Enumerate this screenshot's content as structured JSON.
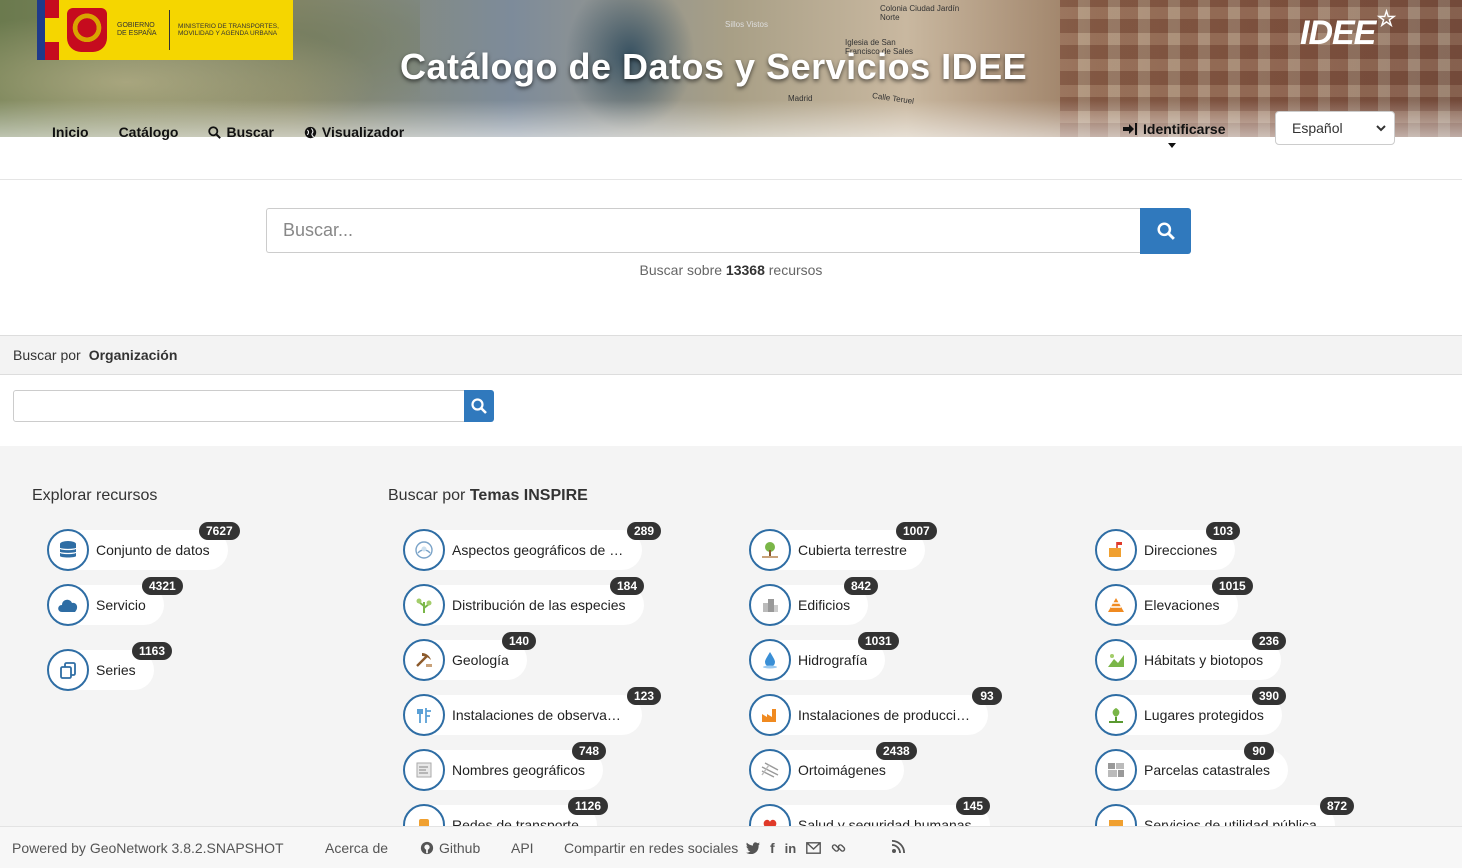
{
  "header": {
    "gov_text": "Gobierno de España",
    "ministry_text": "Ministerio de Transportes, Movilidad y Agenda Urbana",
    "site_title": "Catálogo de Datos y Servicios IDEE",
    "logo_text": "IDEE",
    "map_labels": [
      "Colonia Ciudad Jardín Norte",
      "Iglesia de San Francisco de Sales",
      "Calle Teruel",
      "Madrid",
      "Sillos Vistos"
    ],
    "nav": [
      {
        "label": "Inicio",
        "icon": ""
      },
      {
        "label": "Catálogo",
        "icon": ""
      },
      {
        "label": "Buscar",
        "icon": "search-icon"
      },
      {
        "label": "Visualizador",
        "icon": "globe-icon"
      }
    ],
    "login_label": "Identificarse",
    "language": "Español"
  },
  "search": {
    "placeholder": "Buscar...",
    "count_prefix": "Buscar sobre",
    "count_value": "13368",
    "count_suffix": "recursos"
  },
  "org_search": {
    "prefix": "Buscar por",
    "label": "Organización"
  },
  "explore": {
    "title": "Explorar recursos",
    "items": [
      {
        "label": "Conjunto de datos",
        "count": "7627",
        "icon": "database-icon"
      },
      {
        "label": "Servicio",
        "count": "4321",
        "icon": "cloud-icon"
      },
      {
        "label": "Series",
        "count": "1163",
        "icon": "copy-icon"
      }
    ]
  },
  "inspire": {
    "title_prefix": "Buscar por",
    "title_bold": "Temas INSPIRE",
    "col1": [
      {
        "label": "Aspectos geográficos de car...",
        "count": "289",
        "icon": "meteorological-icon"
      },
      {
        "label": "Distribución de las especies",
        "count": "184",
        "icon": "species-icon"
      },
      {
        "label": "Geología",
        "count": "140",
        "icon": "geology-icon"
      },
      {
        "label": "Instalaciones de observació...",
        "count": "123",
        "icon": "monitoring-icon"
      },
      {
        "label": "Nombres geográficos",
        "count": "748",
        "icon": "geographic-names-icon"
      },
      {
        "label": "Redes de transporte",
        "count": "1126",
        "icon": "transport-icon"
      }
    ],
    "col2": [
      {
        "label": "Cubierta terrestre",
        "count": "1007",
        "icon": "land-cover-icon"
      },
      {
        "label": "Edificios",
        "count": "842",
        "icon": "buildings-icon"
      },
      {
        "label": "Hidrografía",
        "count": "1031",
        "icon": "hydrography-icon"
      },
      {
        "label": "Instalaciones de producción ...",
        "count": "93",
        "icon": "production-icon"
      },
      {
        "label": "Ortoimágenes",
        "count": "2438",
        "icon": "orthoimagery-icon"
      },
      {
        "label": "Salud y seguridad humanas",
        "count": "145",
        "icon": "health-icon"
      }
    ],
    "col3": [
      {
        "label": "Direcciones",
        "count": "103",
        "icon": "addresses-icon"
      },
      {
        "label": "Elevaciones",
        "count": "1015",
        "icon": "elevation-icon"
      },
      {
        "label": "Hábitats y biotopos",
        "count": "236",
        "icon": "habitats-icon"
      },
      {
        "label": "Lugares protegidos",
        "count": "390",
        "icon": "protected-sites-icon"
      },
      {
        "label": "Parcelas catastrales",
        "count": "90",
        "icon": "cadastral-icon"
      },
      {
        "label": "Servicios de utilidad pública",
        "count": "872",
        "icon": "utility-icon"
      }
    ]
  },
  "footer": {
    "powered": "Powered by GeoNetwork 3.8.2.SNAPSHOT",
    "about": "Acerca de",
    "github": "Github",
    "api": "API",
    "share": "Compartir en redes sociales"
  },
  "colors": {
    "accent": "#3079bd",
    "icon_ring": "#2e6da4",
    "badge": "#333333",
    "gov_yellow": "#f5d600"
  }
}
